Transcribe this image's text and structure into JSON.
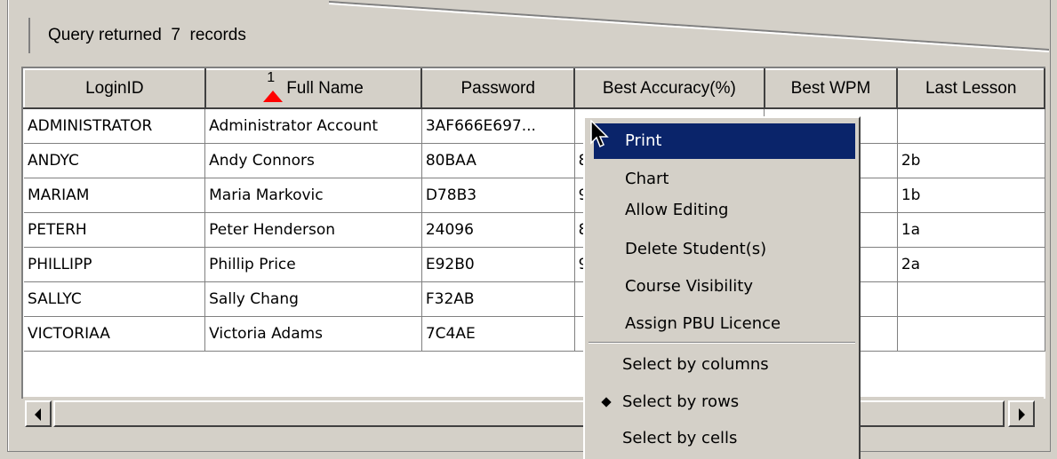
{
  "status": {
    "prefix": "Query returned",
    "count": "7",
    "suffix": "records"
  },
  "table": {
    "sort": {
      "column_index": 1,
      "order_label": "1",
      "indicator_color": "#ff0000"
    },
    "columns": [
      "LoginID",
      "Full Name",
      "Password",
      "Best Accuracy(%)",
      "Best WPM",
      "Last Lesson"
    ],
    "rows": [
      [
        "ADMINISTRATOR",
        "Administrator Account",
        "3AF666E697...",
        "",
        "",
        ""
      ],
      [
        "ANDYC",
        "Andy Connors",
        "80BAA",
        "8",
        "",
        "2b"
      ],
      [
        "MARIAM",
        "Maria Markovic",
        "D78B3",
        "9",
        "",
        "1b"
      ],
      [
        "PETERH",
        "Peter Henderson",
        "24096",
        "8",
        "",
        "1a"
      ],
      [
        "PHILLIPP",
        "Phillip Price",
        "E92B0",
        "9",
        "",
        "2a"
      ],
      [
        "SALLYC",
        "Sally Chang",
        "F32AB",
        "",
        "",
        ""
      ],
      [
        "VICTORIAA",
        "Victoria Adams",
        "7C4AE",
        "",
        "",
        ""
      ]
    ]
  },
  "context_menu": {
    "highlight_color": "#0a246a",
    "items": [
      {
        "label": "Print",
        "highlighted": true
      },
      {
        "label": "Chart"
      },
      {
        "label": "Allow Editing"
      },
      {
        "label": "Delete Student(s)"
      },
      {
        "label": "Course Visibility"
      },
      {
        "label": "Assign PBU Licence"
      }
    ],
    "selection_items": [
      {
        "label": "Select by columns",
        "checked": false
      },
      {
        "label": "Select by rows",
        "checked": true
      },
      {
        "label": "Select by cells",
        "checked": false
      }
    ]
  },
  "icons": {
    "cursor": "arrow-cursor-icon",
    "scroll_left": "arrow-left-icon",
    "scroll_right": "arrow-right-icon",
    "sort_indicator": "sort-ascending-icon"
  }
}
